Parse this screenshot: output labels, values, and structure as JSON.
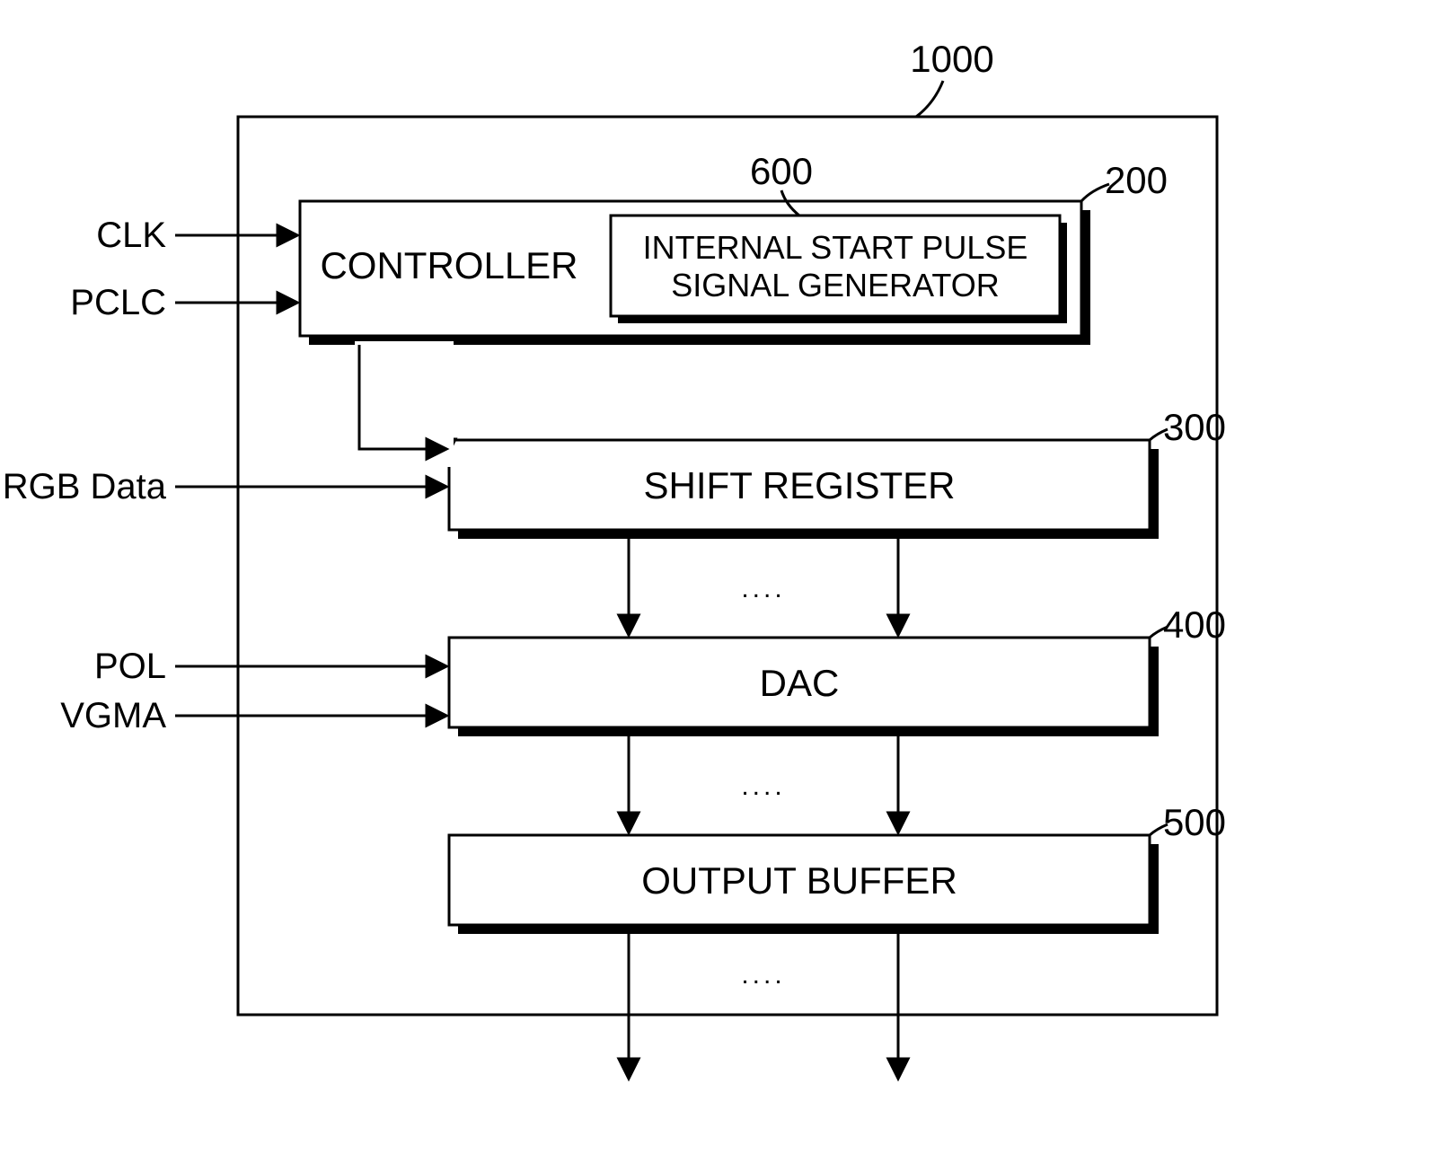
{
  "diagram": {
    "outer_ref": "1000",
    "inputs": {
      "clk": "CLK",
      "pclc": "PCLC",
      "rgb": "RGB Data",
      "pol": "POL",
      "vgma": "VGMA"
    },
    "blocks": {
      "controller": {
        "label": "CONTROLLER",
        "ref": "200",
        "inner": {
          "label_line1": "INTERNAL START PULSE",
          "label_line2": "SIGNAL GENERATOR",
          "ref": "600"
        }
      },
      "shift_register": {
        "label": "SHIFT REGISTER",
        "ref": "300"
      },
      "dac": {
        "label": "DAC",
        "ref": "400"
      },
      "output_buffer": {
        "label": "OUTPUT BUFFER",
        "ref": "500"
      }
    },
    "ellipsis": "...."
  }
}
